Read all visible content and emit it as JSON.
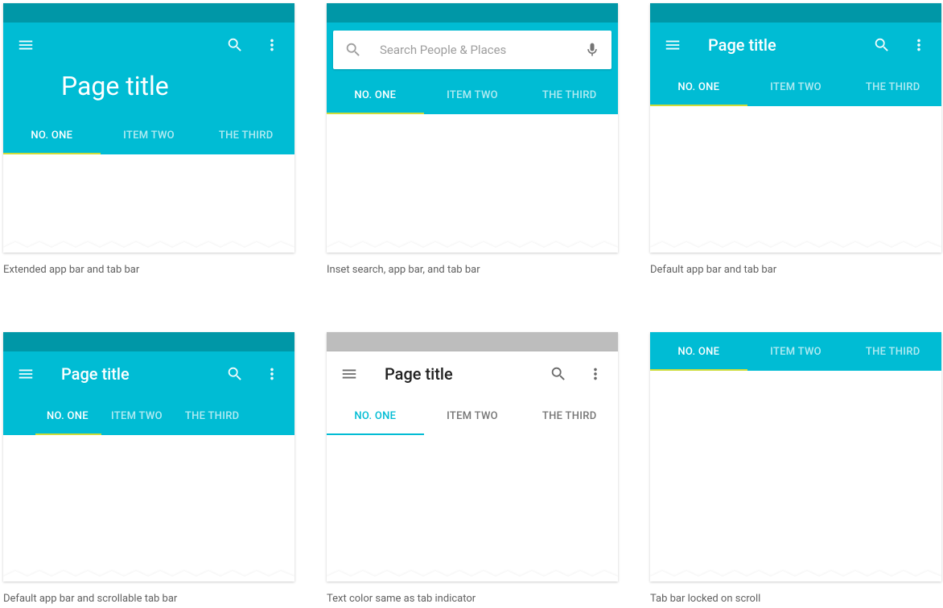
{
  "colors": {
    "primary": "#00BCD4",
    "primary_dark": "#0097A7",
    "accent": "#CDDC39",
    "text_on_primary": "#ffffff",
    "text_dark": "#212121",
    "text_secondary": "#757575"
  },
  "tabs": {
    "one": "NO. ONE",
    "two": "ITEM TWO",
    "three": "THE THIRD"
  },
  "ex1": {
    "title": "Page title",
    "caption": "Extended app bar and tab bar"
  },
  "ex2": {
    "search_placeholder": "Search People  & Places",
    "caption": "Inset search, app bar, and tab bar"
  },
  "ex3": {
    "title": "Page title",
    "caption": "Default app bar and tab bar"
  },
  "ex4": {
    "title": "Page title",
    "caption": "Default app bar and scrollable tab bar"
  },
  "ex5": {
    "title": "Page title",
    "caption": "Text color same as tab indicator"
  },
  "ex6": {
    "caption": "Tab bar locked on scroll"
  }
}
